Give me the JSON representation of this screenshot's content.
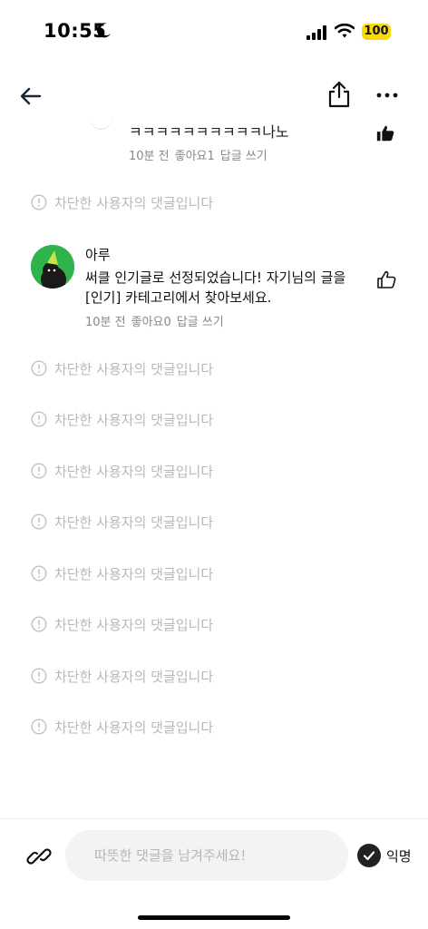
{
  "status_bar": {
    "time": "10:55",
    "battery": "100",
    "battery_color": "#f5d90a"
  },
  "nav": {
    "icons": [
      "arrow-left-icon",
      "share-icon",
      "more-icon"
    ]
  },
  "partial_comment": {
    "text": "ㅋㅋㅋㅋㅋㅋㅋㅋㅋㅋ나노",
    "time": "10분 전",
    "likes": "좋아요1",
    "reply": "답글 쓰기"
  },
  "blocked_text": "차단한 사용자의 댓글입니다",
  "comment": {
    "author": "아루",
    "body": "써클 인기글로 선정되었습니다! 자기님의 글을 [인기] 카테고리에서 찾아보세요.",
    "time": "10분 전",
    "likes": "좋아요0",
    "reply": "답글 쓰기",
    "avatar_color": "#2fb34a"
  },
  "input_bar": {
    "placeholder": "따뜻한 댓글을 남겨주세요!",
    "value": "",
    "anon_label": "익명"
  }
}
